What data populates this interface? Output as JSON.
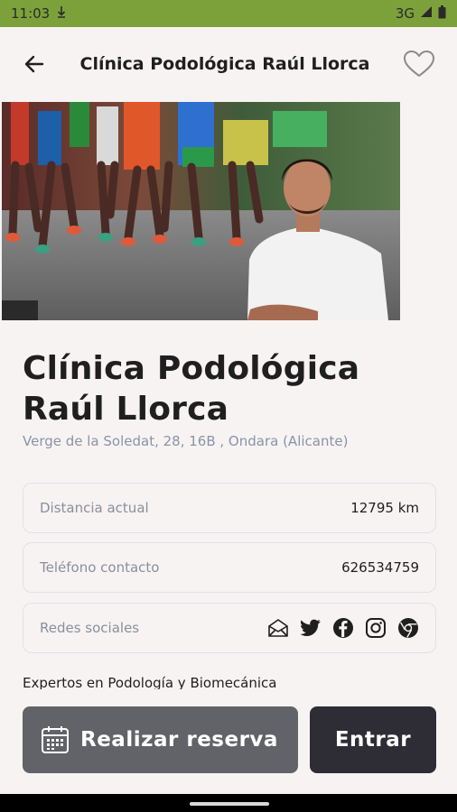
{
  "status_bar": {
    "time": "11:03",
    "network": "3G"
  },
  "app_bar": {
    "title": "Clínica Podológica Raúl Llorca"
  },
  "clinic": {
    "name": "Clínica Podológica Raúl Llorca",
    "address": "Verge de la Soledat, 28, 16B , Ondara (Alicante)",
    "description": "Expertos en Podología y Biomecánica"
  },
  "info": {
    "distance_label": "Distancia actual",
    "distance_value": "12795 km",
    "phone_label": "Teléfono contacto",
    "phone_value": "626534759",
    "social_label": "Redes sociales"
  },
  "icons": [
    "back-arrow-icon",
    "heart-icon",
    "email-icon",
    "twitter-icon",
    "facebook-icon",
    "instagram-icon",
    "web-icon",
    "calendar-icon"
  ],
  "actions": {
    "book_label": "Realizar reserva",
    "enter_label": "Entrar"
  },
  "colors": {
    "status_bar": "#7ca13a",
    "book_button": "#616368",
    "enter_button": "#2e2d35",
    "address": "#8a93a8"
  }
}
